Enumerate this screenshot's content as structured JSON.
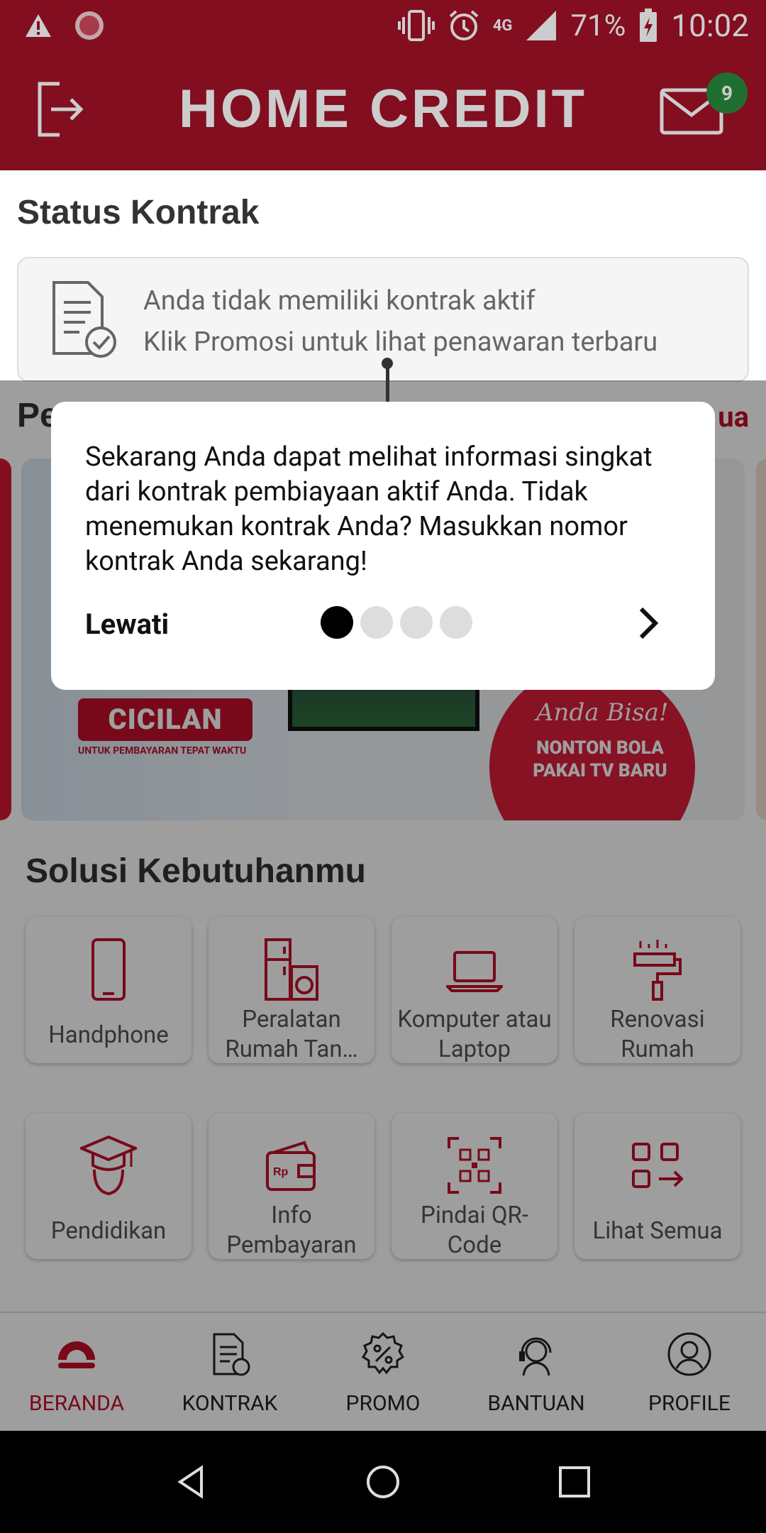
{
  "status_bar": {
    "battery": "71%",
    "time": "10:02",
    "network": "4G"
  },
  "header": {
    "brand": "HOME CREDIT",
    "notification_count": "9"
  },
  "status_contract": {
    "title": "Status Kontrak",
    "line1": "Anda tidak memiliki kontrak aktif",
    "line2": "Klik Promosi untuk lihat penawaran terbaru"
  },
  "promo": {
    "title_partial": "Pe",
    "see_all_partial": "ua",
    "banner": {
      "badge": "CICILAN",
      "badge_sub": "UNTUK PEMBAYARAN TEPAT WAKTU",
      "tagline": "Anda Bisa!",
      "headline": "NONTON BOLA PAKAI TV BARU"
    }
  },
  "solutions": {
    "title": "Solusi Kebutuhanmu",
    "items": [
      {
        "label": "Handphone",
        "icon": "phone-icon"
      },
      {
        "label": "Peralatan Rumah Tan…",
        "icon": "appliance-icon"
      },
      {
        "label": "Komputer atau Laptop",
        "icon": "laptop-icon"
      },
      {
        "label": "Renovasi Rumah",
        "icon": "paint-roller-icon"
      },
      {
        "label": "Pendidikan",
        "icon": "graduation-icon"
      },
      {
        "label": "Info Pembayaran",
        "icon": "wallet-icon"
      },
      {
        "label": "Pindai QR-Code",
        "icon": "qr-scan-icon"
      },
      {
        "label": "Lihat Semua",
        "icon": "grid-arrow-icon"
      }
    ]
  },
  "bottom_nav": {
    "items": [
      {
        "label": "BERANDA",
        "icon": "home-icon",
        "active": true
      },
      {
        "label": "KONTRAK",
        "icon": "contract-icon"
      },
      {
        "label": "PROMO",
        "icon": "promo-icon"
      },
      {
        "label": "BANTUAN",
        "icon": "support-icon"
      },
      {
        "label": "PROFILE",
        "icon": "profile-icon"
      }
    ]
  },
  "tooltip": {
    "text": "Sekarang Anda dapat melihat informasi singkat dari kontrak pembiayaan aktif Anda. Tidak menemukan kontrak Anda? Masukkan nomor kontrak Anda sekarang!",
    "skip": "Lewati",
    "step_current": 1,
    "step_total": 4
  },
  "colors": {
    "brand_red": "#a31228",
    "accent_red": "#c2102a",
    "badge_green": "#2a8a3e"
  }
}
